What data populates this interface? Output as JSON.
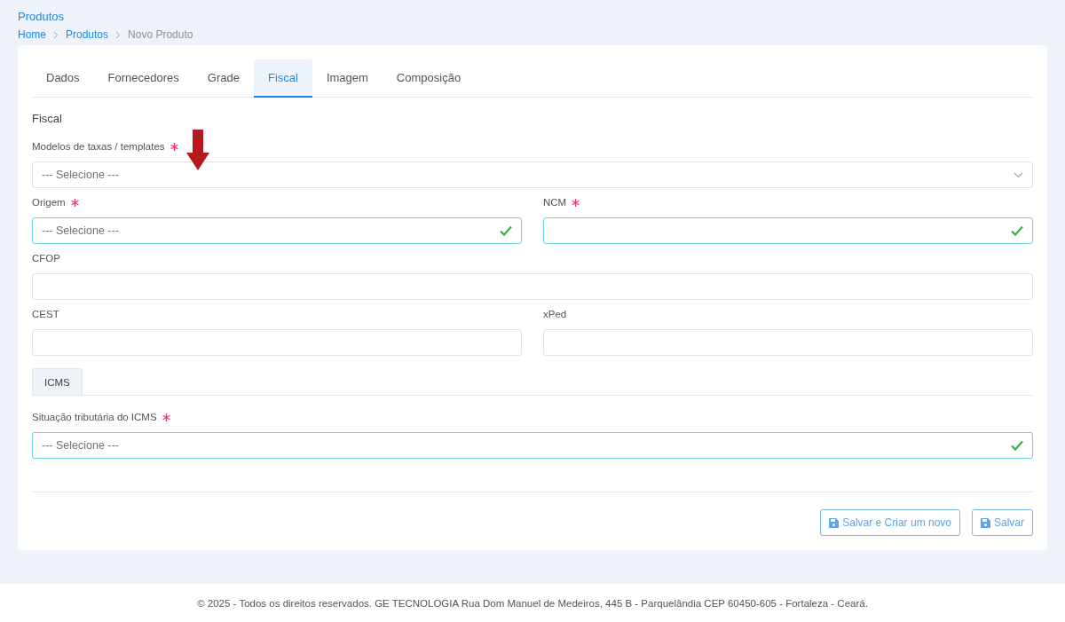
{
  "page_title": "Produtos",
  "breadcrumb": [
    {
      "label": "Home",
      "current": false
    },
    {
      "label": "Produtos",
      "current": false
    },
    {
      "label": "Novo Produto",
      "current": true
    }
  ],
  "tabs": [
    {
      "label": "Dados",
      "selected": false
    },
    {
      "label": "Fornecedores",
      "selected": false
    },
    {
      "label": "Grade",
      "selected": false
    },
    {
      "label": "Fiscal",
      "selected": true
    },
    {
      "label": "Imagem",
      "selected": false
    },
    {
      "label": "Composição",
      "selected": false
    }
  ],
  "section_title": "Fiscal",
  "rows": [
    [
      {
        "kind": "select",
        "label": "Modelos de taxas / templates",
        "required": true,
        "valid": false,
        "placeholder": "--- Selecione ---"
      }
    ],
    [
      {
        "kind": "select",
        "label": "Origem",
        "required": true,
        "valid": true,
        "placeholder": "--- Selecione ---"
      },
      {
        "kind": "text",
        "label": "NCM",
        "required": true,
        "valid": true
      }
    ],
    [
      {
        "kind": "text",
        "label": "CFOP",
        "required": false,
        "valid": false
      }
    ],
    [
      {
        "kind": "text",
        "label": "CEST",
        "required": false,
        "valid": false
      },
      {
        "kind": "text",
        "label": "xPed",
        "required": false,
        "valid": false
      }
    ]
  ],
  "sub_tabs": [
    {
      "label": "ICMS",
      "selected": true
    }
  ],
  "icms_rows": [
    [
      {
        "kind": "select",
        "label": "Situação tributária do ICMS",
        "required": true,
        "valid": true,
        "placeholder": "--- Selecione ---"
      }
    ]
  ],
  "buttons": [
    {
      "label": "Salvar e Criar um novo"
    },
    {
      "label": "Salvar"
    }
  ],
  "footer": "© 2025 - Todos os direitos reservados. GE TECNOLOGIA Rua Dom Manuel de Medeiros, 445 B - Parquelândia CEP 60450-605 - Fortaleza - Ceará."
}
